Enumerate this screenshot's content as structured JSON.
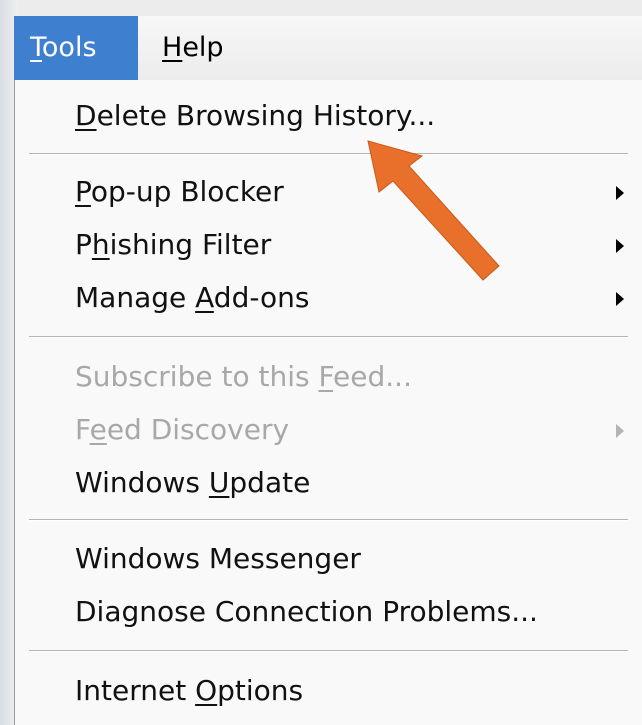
{
  "menubar": {
    "items": [
      {
        "label": "Tools",
        "mnemonic": "T",
        "rest": "ools",
        "active": true
      },
      {
        "label": "Help",
        "mnemonic": "H",
        "rest": "elp",
        "active": false
      }
    ]
  },
  "tools_menu": {
    "delete_history": {
      "pre": "",
      "mnemonic": "D",
      "post": "elete Browsing History..."
    },
    "popup_blocker": {
      "pre": "",
      "mnemonic": "P",
      "post": "op-up Blocker"
    },
    "phishing_filter": {
      "pre": "P",
      "mnemonic": "h",
      "post": "ishing Filter"
    },
    "manage_addons": {
      "pre": "Manage ",
      "mnemonic": "A",
      "post": "dd-ons"
    },
    "subscribe_feed": {
      "pre": "Subscribe to this ",
      "mnemonic": "F",
      "post": "eed..."
    },
    "feed_discovery": {
      "pre": "F",
      "mnemonic": "e",
      "post": "ed Discovery"
    },
    "windows_update": {
      "pre": "Windows ",
      "mnemonic": "U",
      "post": "pdate"
    },
    "windows_messenger": {
      "label": "Windows Messenger"
    },
    "diagnose": {
      "label": "Diagnose Connection Problems..."
    },
    "internet_options": {
      "pre": "Internet ",
      "mnemonic": "O",
      "post": "ptions"
    }
  },
  "annotation": {
    "color": "#e8702a"
  }
}
